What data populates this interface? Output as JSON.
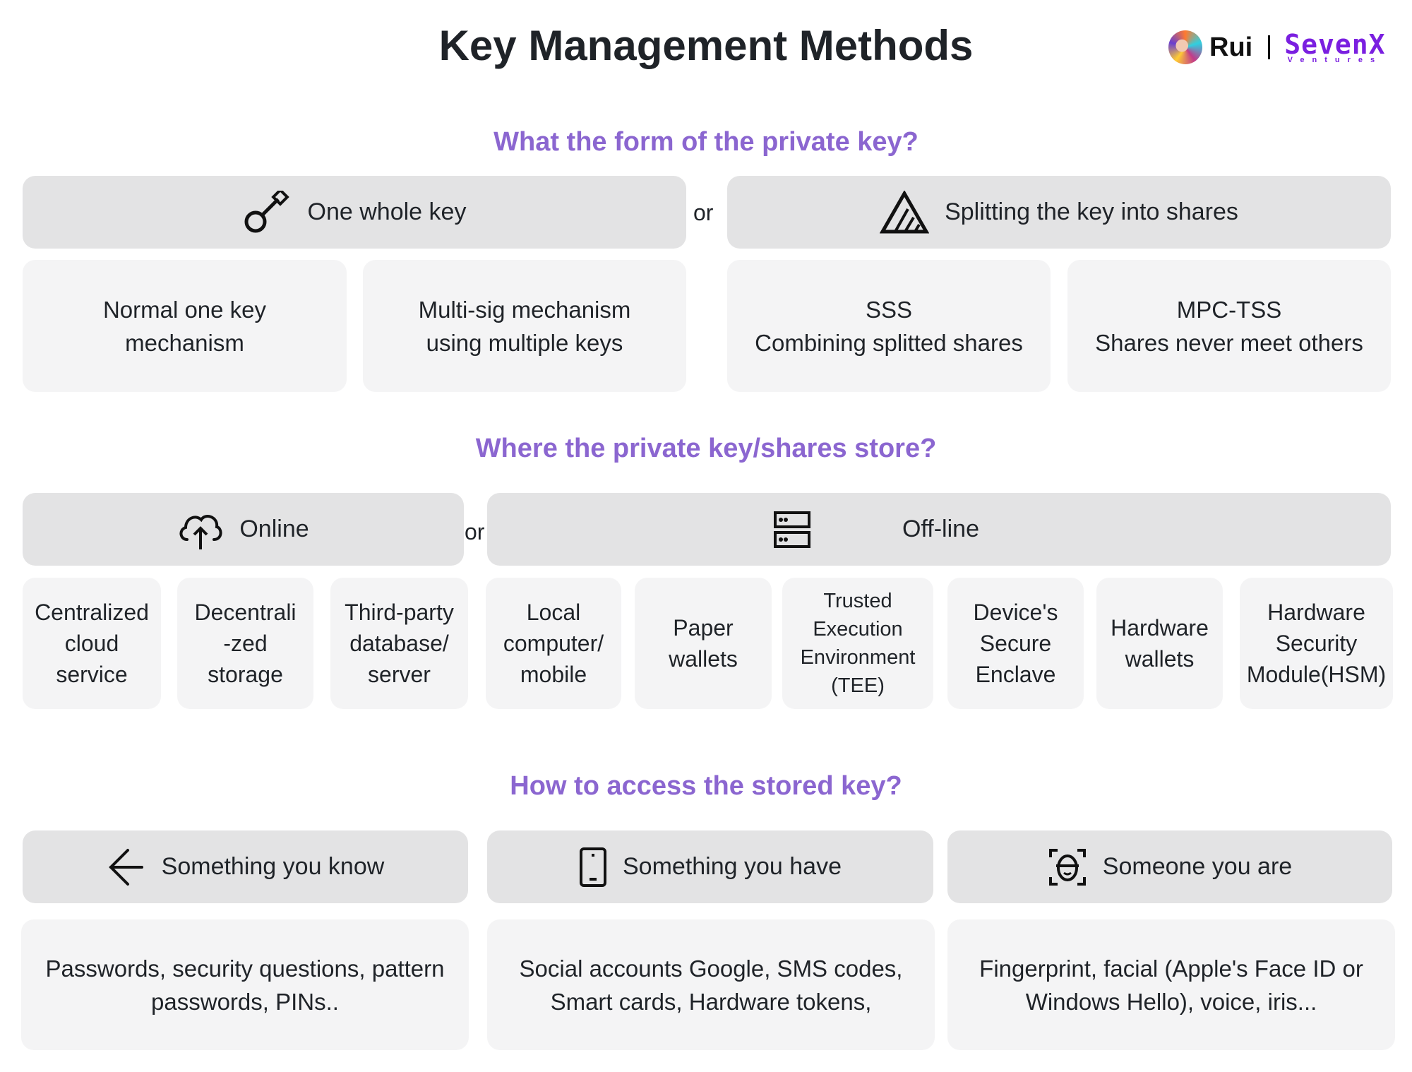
{
  "title": "Key Management Methods",
  "brand": {
    "author": "Rui",
    "company": "SevenX",
    "company_sub": "Ventures",
    "company_color": "#7a1fe0"
  },
  "colors": {
    "question": "#8b66d0",
    "header_bg": "#e3e3e4",
    "item_bg": "#f4f4f5",
    "text": "#1f2328"
  },
  "or_label": "or",
  "form": {
    "question": "What the form of the private key?",
    "options": [
      {
        "label": "One whole key",
        "icon": "key-icon",
        "items": [
          "Normal one key\nmechanism",
          "Multi-sig mechanism\nusing multiple keys"
        ]
      },
      {
        "label": "Splitting the key into shares",
        "icon": "split-triangle-icon",
        "items": [
          "SSS\nCombining splitted shares",
          "MPC-TSS\nShares never meet others"
        ]
      }
    ]
  },
  "storage": {
    "question": "Where the private key/shares store?",
    "options": [
      {
        "label": "Online",
        "icon": "cloud-upload-icon",
        "items": [
          "Centralized\ncloud\nservice",
          "Decentrali\n-zed\nstorage",
          "Third-party\ndatabase/\nserver"
        ]
      },
      {
        "label": "Off-line",
        "icon": "server-icon",
        "items": [
          "Local\ncomputer/\nmobile",
          "Paper\nwallets",
          "Trusted\nExecution\nEnvironment\n(TEE)",
          "Device's\nSecure\nEnclave",
          "Hardware\nwallets",
          "Hardware\nSecurity\nModule(HSM)"
        ]
      }
    ]
  },
  "access": {
    "question": "How to access the stored key?",
    "options": [
      {
        "label": "Something you know",
        "icon": "arrow-left-icon",
        "detail": "Passwords, security questions, pattern\npasswords, PINs.."
      },
      {
        "label": "Something you have",
        "icon": "smartphone-icon",
        "detail": "Social accounts Google, SMS codes,\nSmart cards, Hardware tokens,"
      },
      {
        "label": "Someone you are",
        "icon": "face-scan-icon",
        "detail": "Fingerprint, facial (Apple's Face ID or\nWindows Hello), voice, iris..."
      }
    ]
  }
}
